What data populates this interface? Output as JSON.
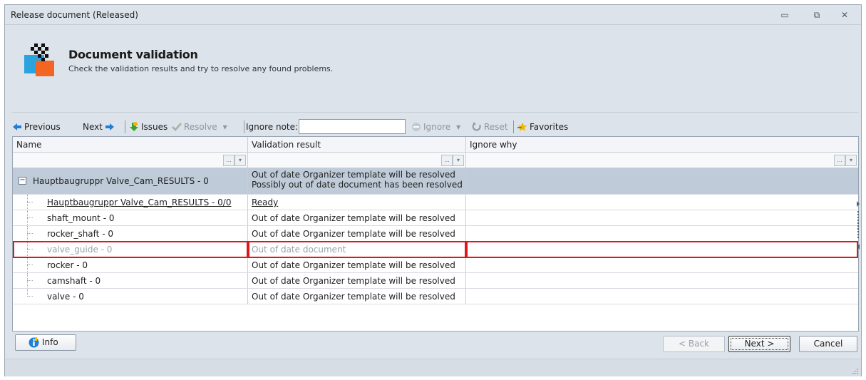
{
  "window": {
    "title": "Release document (Released)",
    "controls": {
      "minimize": "▭",
      "restore": "⧉",
      "close": "✕"
    }
  },
  "header": {
    "title": "Document validation",
    "subtitle": "Check the validation results and try to resolve any found problems."
  },
  "toolbar": {
    "previous": "Previous",
    "next": "Next",
    "issues": "Issues",
    "resolve": "Resolve",
    "ignore_note_label": "Ignore note:",
    "ignore_note_value": "",
    "ignore": "Ignore",
    "reset": "Reset",
    "favorites": "Favorites",
    "dropdown_glyph": "▾"
  },
  "grid": {
    "columns": [
      "Name",
      "Validation result",
      "Ignore why"
    ],
    "filter_glyphs": {
      "ellipsis": "...",
      "dropdown": "▾"
    },
    "group": {
      "expander": "−",
      "name": "Hauptbaugruppr Valve_Cam_RESULTS - 0",
      "result_line1": "Out of date Organizer template will be resolved",
      "result_line2": "Possibly out of date document has been resolved",
      "ignore_why": ""
    },
    "rows": [
      {
        "name": "Hauptbaugruppr Valve_Cam_RESULTS - 0/0",
        "result": "Ready",
        "ignore_why": ""
      },
      {
        "name": "shaft_mount - 0",
        "result": "Out of date Organizer template will be resolved",
        "ignore_why": ""
      },
      {
        "name": "rocker_shaft - 0",
        "result": "Out of date Organizer template will be resolved",
        "ignore_why": ""
      },
      {
        "name": "valve_guide - 0",
        "result": "Out of date document",
        "ignore_why": ""
      },
      {
        "name": "rocker - 0",
        "result": "Out of date Organizer template will be resolved",
        "ignore_why": ""
      },
      {
        "name": "camshaft - 0",
        "result": "Out of date Organizer template will be resolved",
        "ignore_why": ""
      },
      {
        "name": "valve - 0",
        "result": "Out of date Organizer template will be resolved",
        "ignore_why": ""
      }
    ]
  },
  "footer": {
    "info": "Info",
    "back": "< Back",
    "next": "Next >",
    "cancel": "Cancel"
  },
  "colors": {
    "highlight_border": "#e0161b",
    "group_row": "#bfcbd8",
    "accent_blue": "#1f7fd6",
    "favorites_star": "#f2b705"
  }
}
